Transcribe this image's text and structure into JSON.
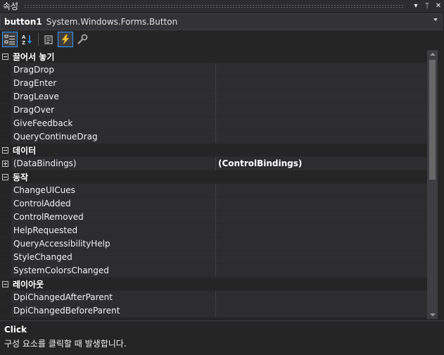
{
  "window": {
    "title": "속성",
    "pin_glyph": "ᛘ",
    "dropdown_glyph": "▾",
    "close_glyph": "✕"
  },
  "object_selector": {
    "name": "button1",
    "type": "System.Windows.Forms.Button"
  },
  "toolbar": {
    "icons": [
      "categorized-icon",
      "alphabetical-icon",
      "properties-icon",
      "events-icon",
      "property-pages-icon"
    ],
    "active": [
      "categorized",
      "events"
    ]
  },
  "grid": {
    "categories": [
      {
        "label": "끌어서 놓기",
        "expanded": true,
        "rows": [
          {
            "name": "DragDrop",
            "value": ""
          },
          {
            "name": "DragEnter",
            "value": ""
          },
          {
            "name": "DragLeave",
            "value": ""
          },
          {
            "name": "DragOver",
            "value": ""
          },
          {
            "name": "GiveFeedback",
            "value": ""
          },
          {
            "name": "QueryContinueDrag",
            "value": ""
          }
        ]
      },
      {
        "label": "데이터",
        "expanded": true,
        "rows": [
          {
            "name": "(DataBindings)",
            "value": "(ControlBindings)",
            "expandable": true
          }
        ]
      },
      {
        "label": "동작",
        "expanded": true,
        "rows": [
          {
            "name": "ChangeUICues",
            "value": ""
          },
          {
            "name": "ControlAdded",
            "value": ""
          },
          {
            "name": "ControlRemoved",
            "value": ""
          },
          {
            "name": "HelpRequested",
            "value": ""
          },
          {
            "name": "QueryAccessibilityHelp",
            "value": ""
          },
          {
            "name": "StyleChanged",
            "value": ""
          },
          {
            "name": "SystemColorsChanged",
            "value": ""
          }
        ]
      },
      {
        "label": "레이아웃",
        "expanded": true,
        "rows": [
          {
            "name": "DpiChangedAfterParent",
            "value": ""
          },
          {
            "name": "DpiChangedBeforeParent",
            "value": ""
          }
        ]
      }
    ]
  },
  "description": {
    "title": "Click",
    "text": "구성 요소를 클릭할 때 발생합니다."
  },
  "colors": {
    "background": "#252526",
    "row": "#2d2d30",
    "accent": "#3399ff"
  }
}
